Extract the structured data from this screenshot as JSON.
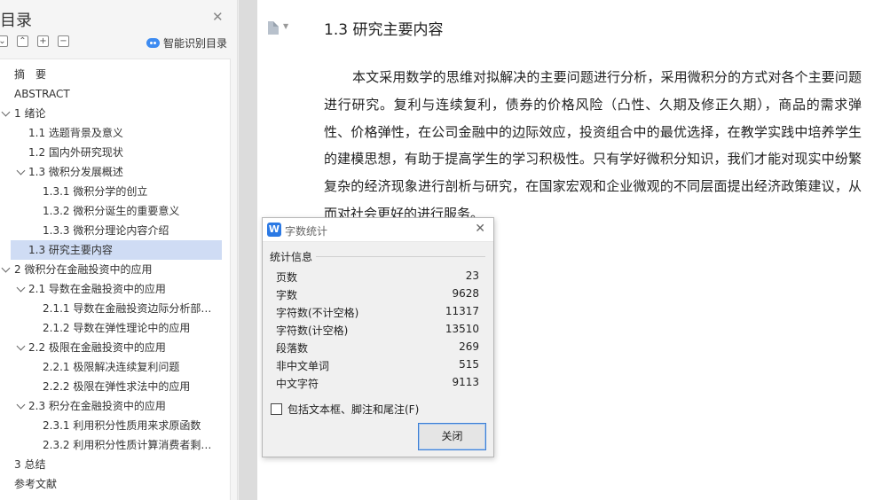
{
  "nav": {
    "title": "目录",
    "smart_label": "智能识别目录",
    "items": [
      {
        "label": "摘　要",
        "level": 1,
        "expandable": false,
        "selected": false
      },
      {
        "label": "ABSTRACT",
        "level": 1,
        "expandable": false,
        "selected": false
      },
      {
        "label": "1 绪论",
        "level": 1,
        "expandable": true,
        "selected": false
      },
      {
        "label": "1.1 选题背景及意义",
        "level": 2,
        "expandable": false,
        "selected": false
      },
      {
        "label": "1.2 国内外研究现状",
        "level": 2,
        "expandable": false,
        "selected": false
      },
      {
        "label": "1.3 微积分发展概述",
        "level": 2,
        "expandable": true,
        "selected": false
      },
      {
        "label": "1.3.1 微积分学的创立",
        "level": 3,
        "expandable": false,
        "selected": false
      },
      {
        "label": "1.3.2 微积分诞生的重要意义",
        "level": 3,
        "expandable": false,
        "selected": false
      },
      {
        "label": "1.3.3 微积分理论内容介绍",
        "level": 3,
        "expandable": false,
        "selected": false
      },
      {
        "label": "1.3 研究主要内容",
        "level": 2,
        "expandable": false,
        "selected": true
      },
      {
        "label": "2 微积分在金融投资中的应用",
        "level": 1,
        "expandable": true,
        "selected": false
      },
      {
        "label": "2.1 导数在金融投资中的应用",
        "level": 2,
        "expandable": true,
        "selected": false
      },
      {
        "label": "2.1.1 导数在金融投资边际分析部…",
        "level": 3,
        "expandable": false,
        "selected": false
      },
      {
        "label": "2.1.2 导数在弹性理论中的应用",
        "level": 3,
        "expandable": false,
        "selected": false
      },
      {
        "label": "2.2 极限在金融投资中的应用",
        "level": 2,
        "expandable": true,
        "selected": false
      },
      {
        "label": "2.2.1 极限解决连续复利问题",
        "level": 3,
        "expandable": false,
        "selected": false
      },
      {
        "label": "2.2.2 极限在弹性求法中的应用",
        "level": 3,
        "expandable": false,
        "selected": false
      },
      {
        "label": "2.3 积分在金融投资中的应用",
        "level": 2,
        "expandable": true,
        "selected": false
      },
      {
        "label": "2.3.1 利用积分性质用来求原函数",
        "level": 3,
        "expandable": false,
        "selected": false
      },
      {
        "label": "2.3.2 利用积分性质计算消费者剩…",
        "level": 3,
        "expandable": false,
        "selected": false
      },
      {
        "label": "3 总结",
        "level": 1,
        "expandable": false,
        "selected": false
      },
      {
        "label": "参考文献",
        "level": 1,
        "expandable": false,
        "selected": false
      }
    ]
  },
  "doc": {
    "heading": "1.3 研究主要内容",
    "paragraph": "本文采用数学的思维对拟解决的主要问题进行分析，采用微积分的方式对各个主要问题进行研究。复利与连续复利，债券的价格风险（凸性、久期及修正久期），商品的需求弹性、价格弹性，在公司金融中的边际效应，投资组合中的最优选择，在教学实践中培养学生的建模思想，有助于提高学生的学习积极性。只有学好微积分知识，我们才能对现实中纷繁复杂的经济现象进行剖析与研究，在国家宏观和企业微观的不同层面提出经济政策建议，从而对社会更好的进行服务。"
  },
  "dialog": {
    "logo_letter": "W",
    "title": "字数统计",
    "group_label": "统计信息",
    "stats": [
      {
        "label": "页数",
        "value": "23"
      },
      {
        "label": "字数",
        "value": "9628"
      },
      {
        "label": "字符数(不计空格)",
        "value": "11317"
      },
      {
        "label": "字符数(计空格)",
        "value": "13510"
      },
      {
        "label": "段落数",
        "value": "269"
      },
      {
        "label": "非中文单词",
        "value": "515"
      },
      {
        "label": "中文字符",
        "value": "9113"
      }
    ],
    "checkbox_label": "包括文本框、脚注和尾注(F)",
    "checkbox_checked": false,
    "close_button": "关闭"
  },
  "colors": {
    "selected_bg": "#cfdcf4",
    "accent": "#2b79e4"
  }
}
